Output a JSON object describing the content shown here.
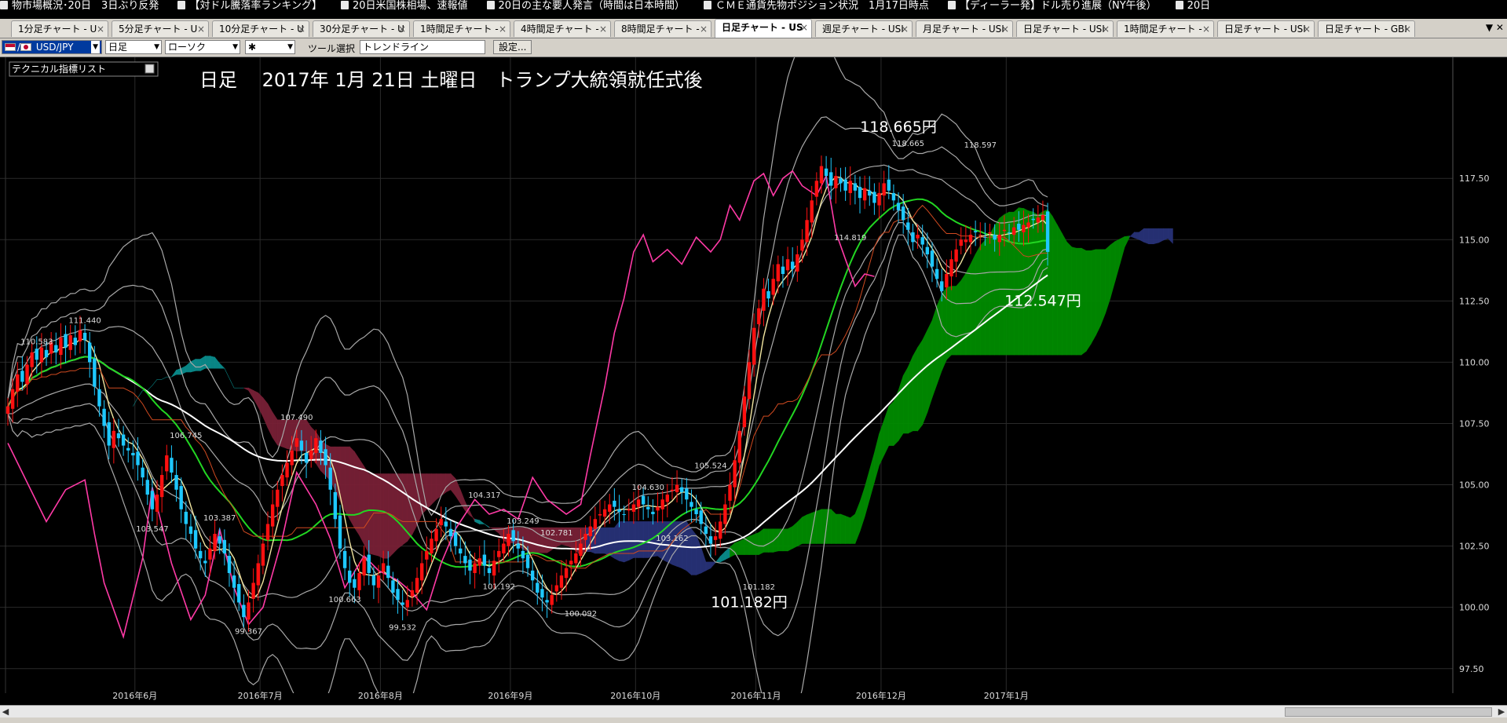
{
  "ticker": [
    "物市場概況･20日　3日ぶり反発",
    "【対ドル騰落率ランキング】",
    "20日米国株相場、速報値",
    "20日の主な要人発言（時間は日本時間）",
    "ＣＭＥ通貨先物ポジション状況　1月17日時点",
    "【ディーラー発】ドル売り進展（NY午後）",
    "20日"
  ],
  "tabs": [
    {
      "label": "1分足チャート - U"
    },
    {
      "label": "5分足チャート - U"
    },
    {
      "label": "10分足チャート - U"
    },
    {
      "label": "30分足チャート - U"
    },
    {
      "label": "1時間足チャート -"
    },
    {
      "label": "4時間足チャート -"
    },
    {
      "label": "8時間足チャート -"
    },
    {
      "label": "日足チャート - US",
      "active": true
    },
    {
      "label": "週足チャート - USI"
    },
    {
      "label": "月足チャート - USI"
    },
    {
      "label": "日足チャート - USI"
    },
    {
      "label": "1時間足チャート -"
    },
    {
      "label": "日足チャート - USI"
    },
    {
      "label": "日足チャート - GBI"
    }
  ],
  "tab_menu": "▼ ✕",
  "toolbar": {
    "pair": "USD/JPY",
    "timeframe": "日足",
    "chart_type": "ローソク",
    "marker": "✱",
    "tool_label": "ツール選択",
    "tool_value": "トレンドライン",
    "settings_label": "設定..."
  },
  "indicator_list_label": "テクニカル指標リスト",
  "colors": {
    "bull": "#ff1010",
    "bear": "#1ec8ff",
    "kumo_green": "#008c00",
    "kumo_teal": "#0a8c8c",
    "kumo_maroon": "#782036",
    "kumo_navy": "#283278",
    "rsi_pink": "#ff3aa6"
  },
  "chart_data": {
    "type": "candlestick",
    "title": "日足　 2017年 1月 21日 土曜日　トランプ大統領就任式後",
    "y_ticks": [
      "117.50",
      "115.00",
      "112.50",
      "110.00",
      "107.50",
      "105.00",
      "102.50",
      "100.00",
      "97.50"
    ],
    "y_tick_values": [
      117.5,
      115.0,
      112.5,
      110.0,
      107.5,
      105.0,
      102.5,
      100.0,
      97.5
    ],
    "ylim": [
      97.3,
      119.7
    ],
    "x_ticks": [
      {
        "label": "2016年6月",
        "index": 6
      },
      {
        "label": "2016年7月",
        "index": 32
      },
      {
        "label": "2016年8月",
        "index": 57
      },
      {
        "label": "2016年9月",
        "index": 84
      },
      {
        "label": "2016年10月",
        "index": 110
      },
      {
        "label": "2016年11月",
        "index": 135
      },
      {
        "label": "2016年12月",
        "index": 161
      },
      {
        "label": "2017年1月",
        "index": 187
      }
    ],
    "n_candles": 217,
    "candle_spacing": 6.13,
    "future_cloud_end_index": 245,
    "price_labels": [
      {
        "text": "111.440",
        "index": 16,
        "value": 111.44,
        "pos": "above"
      },
      {
        "text": "110.583",
        "index": 6,
        "value": 110.58,
        "pos": "above"
      },
      {
        "text": "106.745",
        "index": 37,
        "value": 106.74,
        "pos": "above"
      },
      {
        "text": "107.490",
        "index": 60,
        "value": 107.49,
        "pos": "above"
      },
      {
        "text": "103.547",
        "index": 30,
        "value": 103.54,
        "pos": "below"
      },
      {
        "text": "103.387",
        "index": 44,
        "value": 103.38,
        "pos": "above"
      },
      {
        "text": "99.367",
        "index": 50,
        "value": 99.36,
        "pos": "below"
      },
      {
        "text": "100.663",
        "index": 70,
        "value": 100.66,
        "pos": "below"
      },
      {
        "text": "99.532",
        "index": 82,
        "value": 99.53,
        "pos": "below"
      },
      {
        "text": "104.317",
        "index": 99,
        "value": 104.32,
        "pos": "above"
      },
      {
        "text": "103.249",
        "index": 107,
        "value": 103.25,
        "pos": "above"
      },
      {
        "text": "102.781",
        "index": 114,
        "value": 102.78,
        "pos": "above"
      },
      {
        "text": "101.192",
        "index": 102,
        "value": 101.19,
        "pos": "below"
      },
      {
        "text": "100.092",
        "index": 119,
        "value": 100.09,
        "pos": "below"
      },
      {
        "text": "104.630",
        "index": 133,
        "value": 104.63,
        "pos": "above"
      },
      {
        "text": "103.162",
        "index": 138,
        "value": 103.16,
        "pos": "below"
      },
      {
        "text": "105.524",
        "index": 146,
        "value": 105.52,
        "pos": "above"
      },
      {
        "text": "101.182",
        "index": 156,
        "value": 101.18,
        "pos": "below"
      },
      {
        "text": "114.819",
        "index": 175,
        "value": 114.82,
        "pos": "above"
      },
      {
        "text": "118.665",
        "index": 187,
        "value": 118.66,
        "pos": "above"
      },
      {
        "text": "118.597",
        "index": 202,
        "value": 118.6,
        "pos": "above"
      }
    ],
    "annotations": [
      {
        "text": "118.665円",
        "index": 185,
        "value": 119.4
      },
      {
        "text": "112.547円",
        "index": 215,
        "value": 112.3
      },
      {
        "text": "101.182円",
        "index": 154,
        "value": 100.0
      }
    ],
    "closes": [
      108.2,
      108.9,
      109.5,
      109.2,
      109.9,
      110.4,
      110.1,
      110.6,
      110.2,
      110.8,
      110.4,
      111.0,
      110.6,
      111.1,
      110.7,
      111.3,
      110.9,
      110.0,
      109.0,
      108.2,
      107.4,
      106.6,
      107.2,
      106.9,
      106.6,
      106.4,
      106.2,
      105.8,
      105.3,
      104.6,
      104.0,
      104.6,
      105.4,
      106.2,
      105.5,
      104.8,
      104.0,
      103.4,
      103.0,
      102.4,
      102.0,
      101.8,
      102.4,
      103.0,
      102.6,
      102.2,
      101.4,
      100.8,
      100.2,
      99.6,
      100.2,
      101.0,
      101.8,
      102.6,
      103.4,
      104.2,
      104.8,
      105.4,
      105.9,
      106.4,
      106.9,
      106.4,
      105.9,
      106.4,
      106.9,
      106.3,
      105.8,
      104.8,
      103.6,
      102.4,
      101.6,
      101.0,
      100.8,
      101.4,
      102.0,
      101.4,
      100.9,
      101.3,
      101.8,
      101.2,
      100.6,
      100.3,
      100.1,
      100.3,
      100.7,
      101.2,
      101.8,
      102.3,
      102.8,
      103.2,
      103.6,
      103.3,
      102.9,
      102.5,
      102.2,
      101.8,
      101.5,
      101.8,
      102.0,
      101.7,
      101.4,
      101.9,
      102.3,
      102.6,
      103.0,
      102.7,
      102.4,
      102.0,
      101.6,
      101.1,
      100.6,
      100.4,
      100.2,
      100.5,
      100.9,
      101.3,
      101.6,
      101.9,
      102.2,
      102.6,
      103.0,
      103.3,
      103.6,
      103.8,
      104.0,
      104.2,
      104.1,
      103.9,
      103.8,
      104.0,
      104.2,
      104.4,
      104.2,
      104.0,
      103.8,
      104.1,
      104.4,
      104.6,
      104.8,
      105.0,
      104.7,
      104.4,
      104.1,
      103.8,
      103.4,
      103.0,
      102.6,
      102.9,
      103.5,
      104.2,
      105.0,
      106.0,
      107.2,
      108.6,
      110.0,
      111.4,
      112.2,
      113.0,
      112.6,
      113.4,
      114.0,
      113.6,
      114.2,
      113.8,
      114.4,
      115.0,
      115.8,
      116.6,
      117.4,
      118.0,
      117.6,
      117.2,
      117.6,
      117.3,
      117.0,
      117.4,
      117.0,
      116.7,
      117.1,
      116.8,
      116.5,
      116.9,
      117.3,
      117.0,
      116.6,
      116.2,
      115.8,
      115.4,
      114.9,
      115.2,
      114.8,
      114.4,
      113.9,
      113.4,
      112.9,
      113.6,
      114.2,
      114.6,
      115.0,
      115.0,
      115.2,
      115.3,
      115.2,
      115.1,
      115.3,
      115.0,
      115.2,
      115.4,
      115.3,
      115.5,
      115.4,
      115.6,
      115.7,
      115.8,
      115.9,
      116.0,
      114.5
    ],
    "rsi_trace": [
      [
        0,
        106.7
      ],
      [
        8,
        103.5
      ],
      [
        12,
        104.8
      ],
      [
        16,
        105.2
      ],
      [
        18,
        103.0
      ],
      [
        20,
        101.0
      ],
      [
        24,
        98.8
      ],
      [
        28,
        102.0
      ],
      [
        30,
        104.9
      ],
      [
        34,
        101.8
      ],
      [
        38,
        99.5
      ],
      [
        41,
        100.5
      ],
      [
        44,
        103.2
      ],
      [
        47,
        100.8
      ],
      [
        50,
        99.3
      ],
      [
        53,
        100.0
      ],
      [
        57,
        102.8
      ],
      [
        60,
        105.5
      ],
      [
        64,
        104.2
      ],
      [
        67,
        102.8
      ],
      [
        70,
        100.8
      ],
      [
        74,
        102.1
      ],
      [
        77,
        101.5
      ],
      [
        81,
        101.1
      ],
      [
        84,
        100.6
      ],
      [
        87,
        99.9
      ],
      [
        90,
        101.8
      ],
      [
        93,
        103.2
      ],
      [
        97,
        104.4
      ],
      [
        100,
        103.8
      ],
      [
        103,
        104.0
      ],
      [
        106,
        103.6
      ],
      [
        109,
        105.3
      ],
      [
        112,
        104.4
      ],
      [
        116,
        103.8
      ],
      [
        119,
        104.2
      ],
      [
        121,
        106.2
      ],
      [
        124,
        109.0
      ],
      [
        126,
        111.2
      ],
      [
        128,
        112.6
      ],
      [
        130,
        114.5
      ],
      [
        132,
        115.2
      ],
      [
        134,
        114.1
      ],
      [
        137,
        114.6
      ],
      [
        140,
        114.0
      ],
      [
        143,
        115.1
      ],
      [
        146,
        114.5
      ],
      [
        148,
        115.0
      ],
      [
        150,
        116.4
      ],
      [
        152,
        115.8
      ],
      [
        155,
        117.4
      ],
      [
        157,
        117.7
      ],
      [
        159,
        116.8
      ],
      [
        161,
        117.5
      ],
      [
        163,
        117.8
      ],
      [
        165,
        117.2
      ],
      [
        168,
        116.8
      ],
      [
        170,
        117.6
      ],
      [
        172,
        115.3
      ],
      [
        174,
        114.2
      ],
      [
        176,
        113.1
      ],
      [
        178,
        113.6
      ],
      [
        180,
        113.5
      ]
    ]
  }
}
